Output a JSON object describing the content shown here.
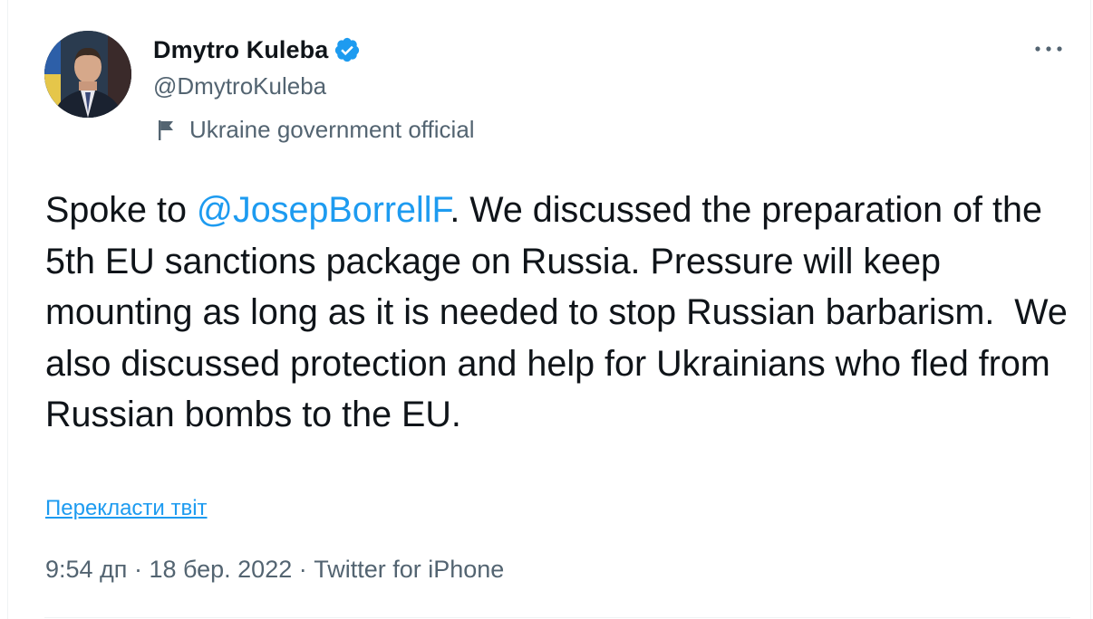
{
  "author": {
    "display_name": "Dmytro Kuleba",
    "handle": "@DmytroKuleba",
    "verified": true,
    "label": "Ukraine government official",
    "avatar_icon": "profile-photo",
    "label_icon": "flag-icon"
  },
  "tweet": {
    "text_before_mention": "Spoke to ",
    "mention": "@JosepBorrellF",
    "text_after_mention": ". We discussed the preparation of the 5th EU sanctions package on Russia. Pressure will keep mounting as long as it is needed to stop Russian barbarism.  We also discussed protection and help for Ukrainians who fled from Russian bombs to the EU."
  },
  "translate_link": "Перекласти твіт",
  "meta": {
    "time": "9:54 дп",
    "separator": " · ",
    "date": "18 бер. 2022",
    "source": "Twitter for iPhone"
  },
  "colors": {
    "accent": "#1d9bf0",
    "secondary_text": "#536471",
    "primary_text": "#0f1419"
  },
  "more_icon": "more-horizontal-icon"
}
